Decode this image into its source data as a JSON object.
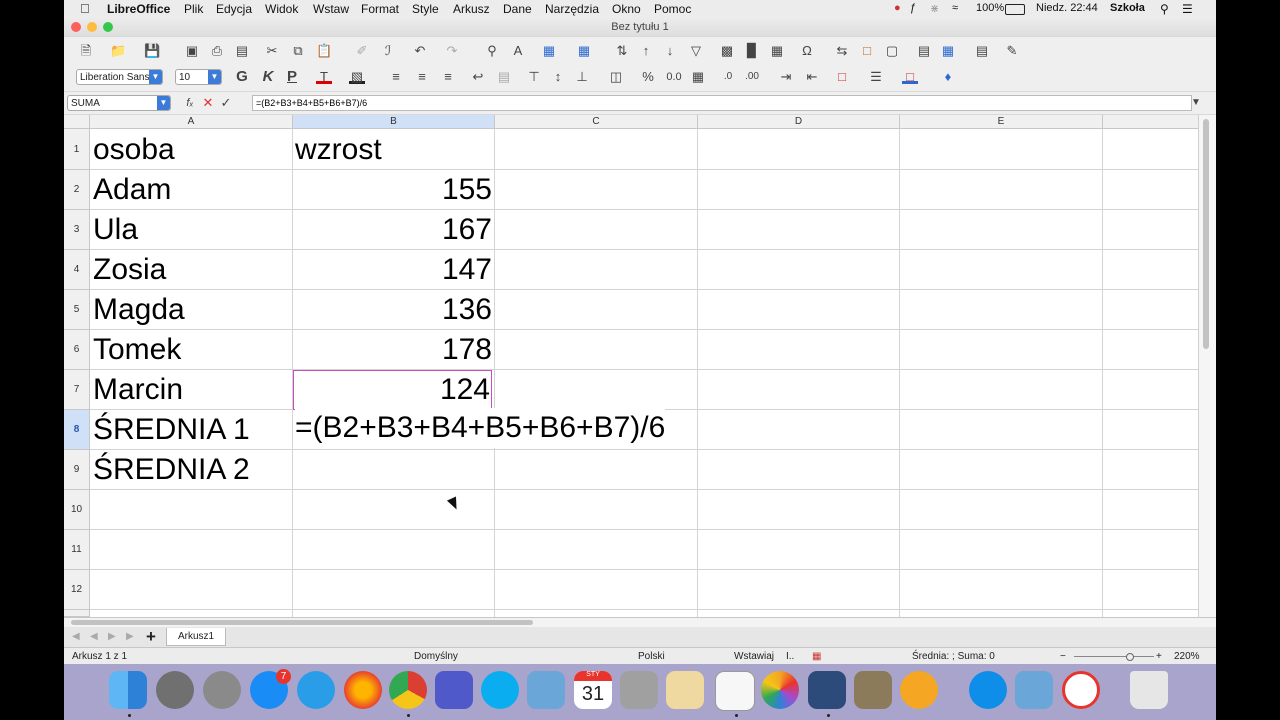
{
  "menubar": {
    "app": "LibreOffice",
    "items": [
      "Plik",
      "Edycja",
      "Widok",
      "Wstaw",
      "Format",
      "Style",
      "Arkusz",
      "Dane",
      "Narzędzia",
      "Okno",
      "Pomoc"
    ],
    "battery": "100%",
    "clock": "Niedz. 22:44",
    "user": "Szkoła"
  },
  "window": {
    "title": "Bez tytułu 1"
  },
  "formatting": {
    "font_name": "Liberation Sans",
    "font_size": "10"
  },
  "formula_bar": {
    "name_box": "SUMA",
    "formula": "=(B2+B3+B4+B5+B6+B7)/6"
  },
  "grid": {
    "columns": [
      "A",
      "B",
      "C",
      "D",
      "E"
    ],
    "rows": [
      "1",
      "2",
      "3",
      "4",
      "5",
      "6",
      "7",
      "8",
      "9",
      "10",
      "11",
      "12"
    ],
    "col_a": [
      "osoba",
      "Adam",
      "Ula",
      "Zosia",
      "Magda",
      "Tomek",
      "Marcin",
      "ŚREDNIA 1",
      "ŚREDNIA 2"
    ],
    "col_b": [
      "wzrost",
      "155",
      "167",
      "147",
      "136",
      "178",
      "124"
    ],
    "editing_cell_text": "=(B2+B3+B4+B5+B6+B7)/6"
  },
  "sheet_tabs": [
    "Arkusz1"
  ],
  "status": {
    "sheet": "Arkusz 1 z 1",
    "style": "Domyślny",
    "language": "Polski",
    "mode": "Wstawiaj",
    "sum": "Średnia: ; Suma: 0",
    "zoom": "220%"
  },
  "dock": {
    "badge_appstore": "7",
    "calendar_month": "STY",
    "calendar_day": "31"
  },
  "colors": {
    "accent": "#3d7bd9",
    "selection_border": "#c64fc6",
    "selected_header": "#cfe0f7",
    "dock": "#a9a4cc"
  }
}
